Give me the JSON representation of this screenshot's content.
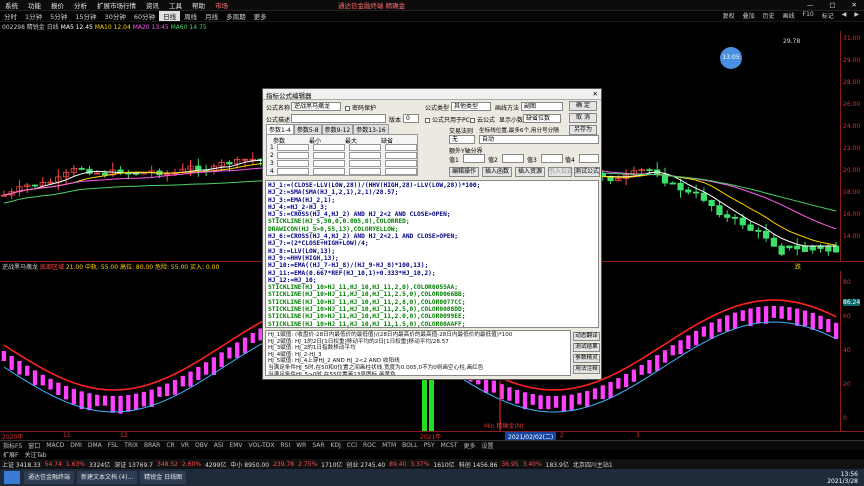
{
  "menu": {
    "items": [
      "系统",
      "功能",
      "报价",
      "分析",
      "扩展市场行情",
      "资讯",
      "工具",
      "帮助",
      "市场"
    ],
    "center": "通达信金融终端   精确金",
    "window_controls": [
      "—",
      "□",
      "✕"
    ]
  },
  "period_bar": {
    "items": [
      "分时",
      "1分钟",
      "5分钟",
      "15分钟",
      "30分钟",
      "60分钟",
      "日线",
      "周线",
      "月线",
      "多周期",
      "更多"
    ],
    "selected": "日线",
    "right_buttons": [
      "复权",
      "叠加",
      "历史",
      "画线",
      "F10",
      "标记",
      "◀",
      "▶"
    ]
  },
  "main_header": {
    "code": "002298 精锐金 日线",
    "ma5": "MA5 12.45",
    "ma10": "MA10 12.04",
    "ma20": "MA20 13.45",
    "ma60": "MA60 14.75"
  },
  "y_axis": [
    "31.00",
    "29.00",
    "28.00",
    "26.00",
    "24.00",
    "22.00",
    "20.00",
    "18.00",
    "16.00",
    "14.00"
  ],
  "price_mark": "29.78",
  "bubble": "13:05",
  "sub_header": {
    "name": "逆战黑马擒龙",
    "a": "底部区域",
    "b": "21.00 中轨: 55.00 高位: 80.00 危险: 55.00 买入: 0.00",
    "right_label": "跌"
  },
  "sub_y_axis": [
    "80",
    "60",
    "40",
    "20",
    "0"
  ],
  "sub_value": "86.24",
  "date_bar": {
    "start": "2020年",
    "marks": [
      "11",
      "12",
      "2021年",
      "2",
      "3"
    ],
    "highlight": "2021/02/02(二)",
    "bottom_note": "Min 精确金(N)"
  },
  "indicator_tabs": [
    "指标F5",
    "窗口",
    "MACD",
    "DMI",
    "DMA",
    "FSL",
    "TRIX",
    "BRAR",
    "CR",
    "VR",
    "OBV",
    "ASI",
    "EMV",
    "VOL-TDX",
    "RSI",
    "WR",
    "SAR",
    "KDJ",
    "CCI",
    "ROC",
    "MTM",
    "BOLL",
    "PSY",
    "MCST",
    "更多",
    "设置"
  ],
  "tabs2": [
    "扩展F",
    "关注Tab"
  ],
  "ticker": [
    {
      "t": "上证 3418.33",
      "c": "wt"
    },
    {
      "t": "54.74",
      "c": "up"
    },
    {
      "t": "1.63%",
      "c": "up"
    },
    {
      "t": "3324亿",
      "c": "wt"
    },
    {
      "t": "深证 13769.7",
      "c": "wt"
    },
    {
      "t": "348.52",
      "c": "up"
    },
    {
      "t": "2.60%",
      "c": "up"
    },
    {
      "t": "4299亿",
      "c": "wt"
    },
    {
      "t": "中小 8950.00",
      "c": "wt"
    },
    {
      "t": "239.78",
      "c": "up"
    },
    {
      "t": "2.75%",
      "c": "up"
    },
    {
      "t": "1710亿",
      "c": "wt"
    },
    {
      "t": "创业 2745.40",
      "c": "wt"
    },
    {
      "t": "89.40",
      "c": "up"
    },
    {
      "t": "3.37%",
      "c": "up"
    },
    {
      "t": "1610亿",
      "c": "wt"
    },
    {
      "t": "科创 1456.86",
      "c": "wt"
    },
    {
      "t": "36.95",
      "c": "up"
    },
    {
      "t": "3.40%",
      "c": "up"
    },
    {
      "t": "183.9亿",
      "c": "wt"
    },
    {
      "t": "北京四川主站1",
      "c": "wt"
    }
  ],
  "taskbar": {
    "apps": [
      "通达信金融终端",
      "新建文本文档 (4)...",
      "精锐金  日线图"
    ],
    "time": "13:56",
    "date": "2021/3/28"
  },
  "dialog": {
    "title": "指标公式编辑器",
    "close": "✕",
    "formula_name_label": "公式名称",
    "formula_name": "逆战黑马擒龙",
    "password_label": "密码保护",
    "formula_desc_label": "公式描述",
    "formula_desc": "",
    "version_label": "版本",
    "version": "0",
    "type_label": "公式类型",
    "type": "其他类型",
    "draw_label": "画线方法",
    "draw": "副图",
    "ok": "确 定",
    "cancel": "取 消",
    "save_as": "另存为",
    "only_label": "公式只用于PC",
    "cloud_label": "云公式",
    "decimal_label": "显示小数",
    "decimal": "缺省位数",
    "trade_rule_label": "交易法则",
    "coord_label": "坐标线位置,最多6个,用分号分隔",
    "coord": "自动",
    "extra_label": "额外Y轴分界",
    "value_labels": [
      "值1",
      "值2",
      "值3",
      "值4"
    ],
    "param_tabs": [
      "参数1-4",
      "参数5-8",
      "参数9-12",
      "参数13-16"
    ],
    "param_headers": [
      "参数",
      "最小",
      "最大",
      "缺省"
    ],
    "param_rows": [
      "1",
      "2",
      "3",
      "4"
    ],
    "action_buttons": [
      "编辑操作",
      "插入函数",
      "插入资源",
      "引入公式",
      "测试公式"
    ],
    "code_lines": [
      {
        "t": "HJ_1:=(CLOSE-LLV(LOW,28))/(HHV(HIGH,28)-LLV(LOW,28))*100;",
        "c": "cb"
      },
      {
        "t": "HJ_2:=SMA(SMA(HJ_1,2,1),2,1)/28.57;",
        "c": "cb"
      },
      {
        "t": "HJ_3:=EMA(HJ_2,1);",
        "c": "cb"
      },
      {
        "t": "HJ_4:=HJ_2-HJ_3;",
        "c": "cb"
      },
      {
        "t": "HJ_5:=CROSS(HJ_4,HJ_2) AND HJ_2<2 AND CLOSE>OPEN;",
        "c": "cb"
      },
      {
        "t": "STICKLINE(HJ_5,50,0,0.005,0),COLORRED;",
        "c": "cg"
      },
      {
        "t": "DRAWICON(HJ_5>0,55,13),COLORYELLOW;",
        "c": "cg"
      },
      {
        "t": "HJ_6:=CROSS(HJ_4,HJ_2) AND HJ_2<2.1 AND CLOSE>OPEN;",
        "c": "cb"
      },
      {
        "t": "HJ_7:=(2*CLOSE+HIGH+LOW)/4;",
        "c": "cb"
      },
      {
        "t": "HJ_8:=LLV(LOW,13);",
        "c": "cb"
      },
      {
        "t": "HJ_9:=HHV(HIGH,13);",
        "c": "cb"
      },
      {
        "t": "HJ_10:=EMA((HJ_7-HJ_8)/(HJ_9-HJ_8)*100,13);",
        "c": "cb"
      },
      {
        "t": "HJ_11:=EMA(0.667*REF(HJ_10,1)+0.333*HJ_10,2);",
        "c": "cb"
      },
      {
        "t": "HJ_12:=HJ_10;",
        "c": "cb"
      },
      {
        "t": "STICKLINE(HJ_10>HJ_11,HJ_10,HJ_11,2,0),COLOR0055AA;",
        "c": "cg"
      },
      {
        "t": "STICKLINE(HJ_10>HJ_11,HJ_10,HJ_11,2.5,0),COLOR0066BB;",
        "c": "cg"
      },
      {
        "t": "STICKLINE(HJ_10>HJ_11,HJ_10,HJ_11,2,8,0),COLOR0077CC;",
        "c": "cg"
      },
      {
        "t": "STICKLINE(HJ_10>HJ_11,HJ_10,HJ_11,2.5,0),COLOR0088DD;",
        "c": "cg"
      },
      {
        "t": "STICKLINE(HJ_10>HJ_11,HJ_10,HJ_11,2.0,0),COLOR0099EE;",
        "c": "cg"
      },
      {
        "t": "STICKLINE(HJ_10>HJ_11,HJ_10,HJ_11,1.5,0),COLOR00AAFF;",
        "c": "cg"
      }
    ],
    "desc_lines": [
      "HJ_1赋值: (收盘价-28日内最低价的最低值)/(28日内最高价的最高值-28日内最低价的最低值)*100",
      "HJ_2赋值: HJ_1的2日[1日权重]移动平均的2日[1日权重]移动平均/28.57",
      "HJ_3赋值: HJ_2的1日指数移动平均",
      "HJ_4赋值: HJ_2-HJ_3",
      "HJ_5赋值: HJ_4上穿HJ_2 AND HJ_2<2 AND 收阳线",
      "当满足条件HJ_5时,在50和0位置之间画柱状线,宽度为0.005,0不为0则画空心柱,画红色",
      "当满足条件HJ_5>0时,在55位置画13号图标,画黄色",
      "HJ_6赋值: HJ_4上穿HJ_2 AND HJ_2<2.1 AND 收阳线"
    ],
    "side_buttons": [
      "动态翻译",
      "测试结果",
      "参数精灵",
      "用法注释"
    ]
  },
  "colors": {
    "up": "#ff4a4a",
    "down": "#3ee06a",
    "ma5": "#ffffff",
    "ma10": "#ffd400",
    "ma20": "#ff5bf0",
    "ma60": "#4bd36b",
    "axis_red": "#8a1e1e",
    "stick_magenta": "#ff40ff",
    "stick_green": "#22dd22"
  }
}
